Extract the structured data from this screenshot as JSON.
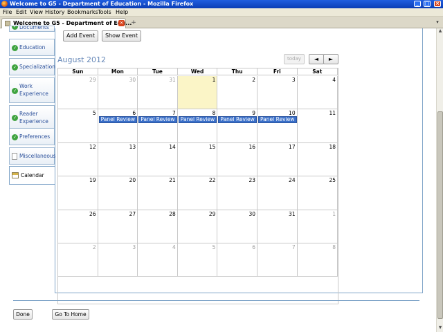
{
  "window": {
    "title": "Welcome to G5 - Department of Education - Mozilla Firefox",
    "min": "_",
    "max": "□",
    "close": "×"
  },
  "menu": [
    "File",
    "Edit",
    "View",
    "History",
    "Bookmarks",
    "Tools",
    "Help"
  ],
  "tab": {
    "title": "Welcome to G5 - Department of Edu...",
    "close": "×",
    "newtab": "+",
    "list": "▾"
  },
  "sidebar": {
    "partial_top": "Documents",
    "items": [
      {
        "label": "Education",
        "icon": "check-icon"
      },
      {
        "label": "Specialization",
        "icon": "check-icon"
      },
      {
        "label": "Work Experience",
        "icon": "check-icon"
      },
      {
        "label": "Reader Experience",
        "icon": "check-icon"
      },
      {
        "label": "Preferences",
        "icon": "check-icon"
      },
      {
        "label": "Miscellaneous",
        "icon": "document-icon"
      },
      {
        "label": "Calendar",
        "icon": "calendar-icon"
      }
    ]
  },
  "toolbar": {
    "add_event": "Add Event",
    "show_event": "Show Event"
  },
  "calendar": {
    "month_title": "August 2012",
    "today_label": "today",
    "prev": "◄",
    "next": "►",
    "days": [
      "Sun",
      "Mon",
      "Tue",
      "Wed",
      "Thu",
      "Fri",
      "Sat"
    ],
    "weeks": [
      [
        {
          "d": "29",
          "o": true
        },
        {
          "d": "30",
          "o": true
        },
        {
          "d": "31",
          "o": true
        },
        {
          "d": "1",
          "t": true
        },
        {
          "d": "2"
        },
        {
          "d": "3"
        },
        {
          "d": "4"
        }
      ],
      [
        {
          "d": "5"
        },
        {
          "d": "6",
          "e": "Panel Review"
        },
        {
          "d": "7",
          "e": "Panel Review"
        },
        {
          "d": "8",
          "e": "Panel Review"
        },
        {
          "d": "9",
          "e": "Panel Review"
        },
        {
          "d": "10",
          "e": "Panel Review"
        },
        {
          "d": "11"
        }
      ],
      [
        {
          "d": "12"
        },
        {
          "d": "13"
        },
        {
          "d": "14"
        },
        {
          "d": "15"
        },
        {
          "d": "16"
        },
        {
          "d": "17"
        },
        {
          "d": "18"
        }
      ],
      [
        {
          "d": "19"
        },
        {
          "d": "20"
        },
        {
          "d": "21"
        },
        {
          "d": "22"
        },
        {
          "d": "23"
        },
        {
          "d": "24"
        },
        {
          "d": "25"
        }
      ],
      [
        {
          "d": "26"
        },
        {
          "d": "27"
        },
        {
          "d": "28"
        },
        {
          "d": "29"
        },
        {
          "d": "30"
        },
        {
          "d": "31"
        },
        {
          "d": "1",
          "o": true
        }
      ],
      [
        {
          "d": "2",
          "o": true
        },
        {
          "d": "3",
          "o": true
        },
        {
          "d": "4",
          "o": true
        },
        {
          "d": "5",
          "o": true
        },
        {
          "d": "6",
          "o": true
        },
        {
          "d": "7",
          "o": true
        },
        {
          "d": "8",
          "o": true
        }
      ]
    ]
  },
  "footer": {
    "done": "Done",
    "go_home": "Go To Home"
  }
}
